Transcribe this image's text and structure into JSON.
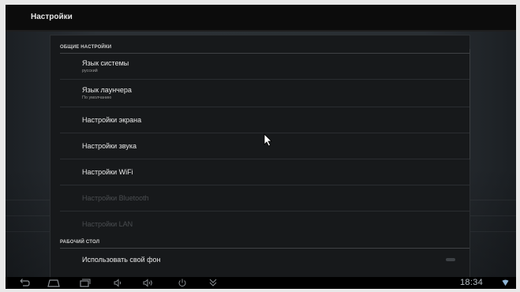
{
  "header": {
    "title": "Настройки"
  },
  "sections": [
    {
      "label": "ОБЩИЕ НАСТРОЙКИ"
    },
    {
      "label": "РАБОЧИЙ СТОЛ"
    }
  ],
  "items": [
    {
      "title": "Язык системы",
      "subtitle": "русский",
      "enabled": true
    },
    {
      "title": "Язык лаунчера",
      "subtitle": "По умолчанию",
      "enabled": true
    },
    {
      "title": "Настройки экрана",
      "enabled": true
    },
    {
      "title": "Настройки звука",
      "enabled": true
    },
    {
      "title": "Настройки WiFi",
      "enabled": true
    },
    {
      "title": "Настройки Bluetooth",
      "enabled": false
    },
    {
      "title": "Настройки LAN",
      "enabled": false
    },
    {
      "title": "Использовать свой фон",
      "enabled": true
    }
  ],
  "toggle": {
    "checked": false
  },
  "navbar": {
    "icons": [
      "back-icon",
      "home-icon",
      "recent-apps-icon",
      "volume-down-icon",
      "volume-up-icon",
      "power-icon",
      "menu-down-icon"
    ]
  },
  "status": {
    "time": "18:34",
    "icon": "wifi-icon"
  },
  "colors": {
    "background": "#000000",
    "panel": "#17191b",
    "text": "#e8e8e8",
    "disabled": "#4a4d50"
  }
}
